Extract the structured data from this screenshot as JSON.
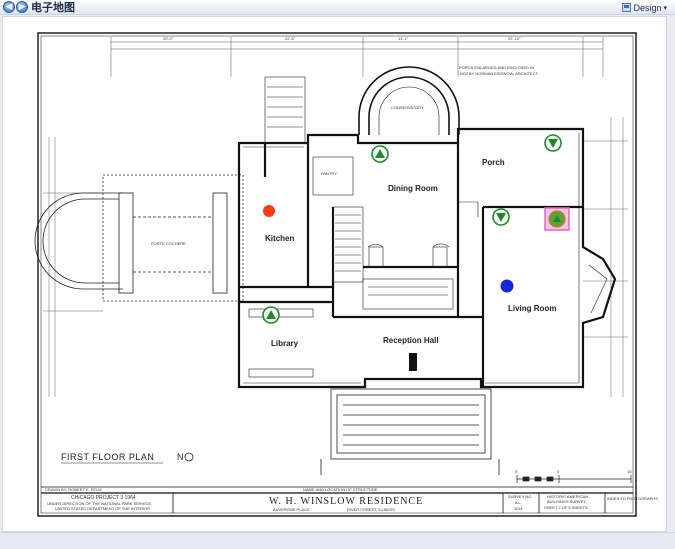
{
  "window": {
    "title": "电子地图",
    "design_label": "Design"
  },
  "plan": {
    "heading": "FIRST FLOOR PLAN",
    "north_label": "N",
    "note_line1": "PORCH ENLARGED AND ENCLOSED IN",
    "note_line2": "1902 BY NORMAN EIDSNOW, ARCHITECT.",
    "dims_top": [
      "20'-0\"",
      "22'-5\"",
      "14'-1\"",
      "22'-10\""
    ],
    "rooms": {
      "kitchen": "Kitchen",
      "dining": "Dining Room",
      "porch": "Porch",
      "living": "Living Room",
      "library": "Library",
      "reception": "Reception Hall",
      "conservatory": "CONSERVATORY",
      "porte_cochere": "PORTE COCHERE",
      "pantry": "PANTRY"
    },
    "drawn_by": "DRAWN BY: ROBERT E. FELM",
    "project": "CHICAGO PROJECT 3 1964",
    "agency_line1": "UNDER DIRECTION OF THE NATIONAL PARK SERVICE,",
    "agency_line2": "UNITED STATES DEPARTMENT OF THE INTERIOR",
    "residence_caption": "NAME AND LOCATION OF STRUCTURE",
    "residence_name": "W. H. WINSLOW  RESIDENCE",
    "residence_loc1": "AUVERGNE PLACE",
    "residence_loc2": "RIVER FOREST, ILLINOIS",
    "survey_label": "SURVEY NO.",
    "survey_no1": "ILL.",
    "survey_no2": "1041",
    "habs_line1": "HISTORIC AMERICAN",
    "habs_line2": "BUILDINGS SURVEY",
    "sheet_info": "SHEET 2 OF 5 SHEETS",
    "index_label": "INDEX TO PHOTOGRAPHS",
    "scale_0": "5'",
    "scale_1": "0",
    "scale_2": "10'"
  },
  "markers": {
    "colors": {
      "red": "#ff3b1a",
      "blue": "#1526d8",
      "green": "#1f8a2a",
      "selection": "#e565c8"
    }
  }
}
